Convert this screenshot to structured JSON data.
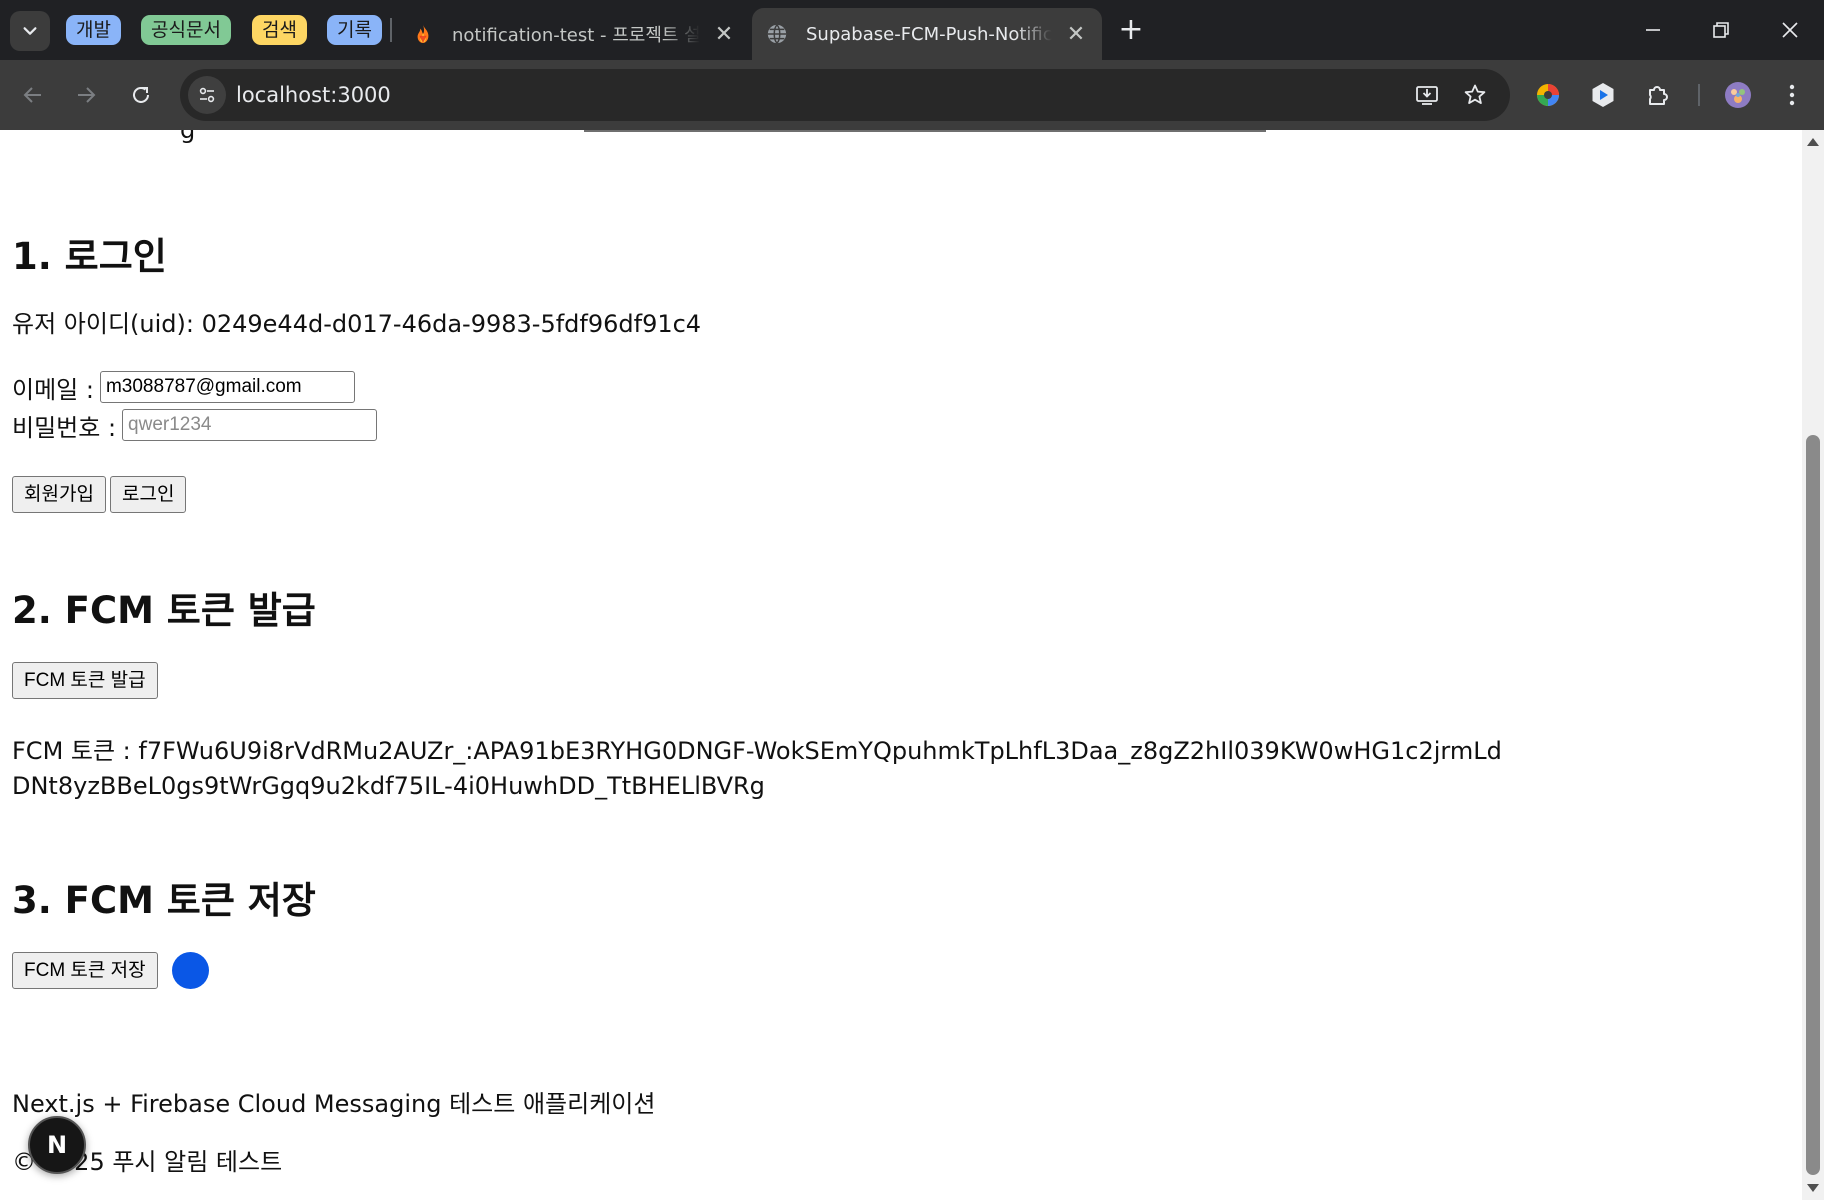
{
  "browser": {
    "tab_groups": [
      {
        "label": "개발",
        "color": "#8ab4f8"
      },
      {
        "label": "공식문서",
        "color": "#81c995"
      },
      {
        "label": "검색",
        "color": "#fdd663"
      },
      {
        "label": "기록",
        "color": "#8ab4f8"
      }
    ],
    "tabs": [
      {
        "title": "notification-test - 프로젝트 설정",
        "icon": "firebase-flame-icon",
        "active": false
      },
      {
        "title": "Supabase-FCM-Push-Notification",
        "icon": "globe-icon",
        "active": true
      }
    ],
    "url": "localhost:3000"
  },
  "page": {
    "top_cut_text": "g",
    "login": {
      "title": "1. 로그인",
      "uid_line": "유저 아이디(uid): 0249e44d-d017-46da-9983-5fdf96df91c4",
      "email_label": "이메일 :",
      "email_value": "m3088787@gmail.com",
      "password_label": "비밀번호 :",
      "password_placeholder": "qwer1234",
      "signup_button": "회원가입",
      "login_button": "로그인"
    },
    "issue": {
      "title": "2. FCM 토큰 발급",
      "button": "FCM 토큰 발급",
      "token_line": "FCM 토큰 : f7FWu6U9i8rVdRMu2AUZr_:APA91bE3RYHG0DNGF-WokSEmYQpuhmkTpLhfL3Daa_z8gZ2hIl039KW0wHG1c2jrmLdDNt8yzBBeL0gs9tWrGgq9u2kdf75IL-4i0HuwhDD_TtBHELlBVRg"
    },
    "save": {
      "title": "3. FCM 토큰 저장",
      "button": "FCM 토큰 저장",
      "indicator_color": "#0a57e6"
    },
    "footer": {
      "description": "Next.js + Firebase Cloud Messaging 테스트 애플리케이션",
      "copyright": "© 2025 푸시 알림 테스트"
    },
    "next_badge_letter": "N"
  }
}
